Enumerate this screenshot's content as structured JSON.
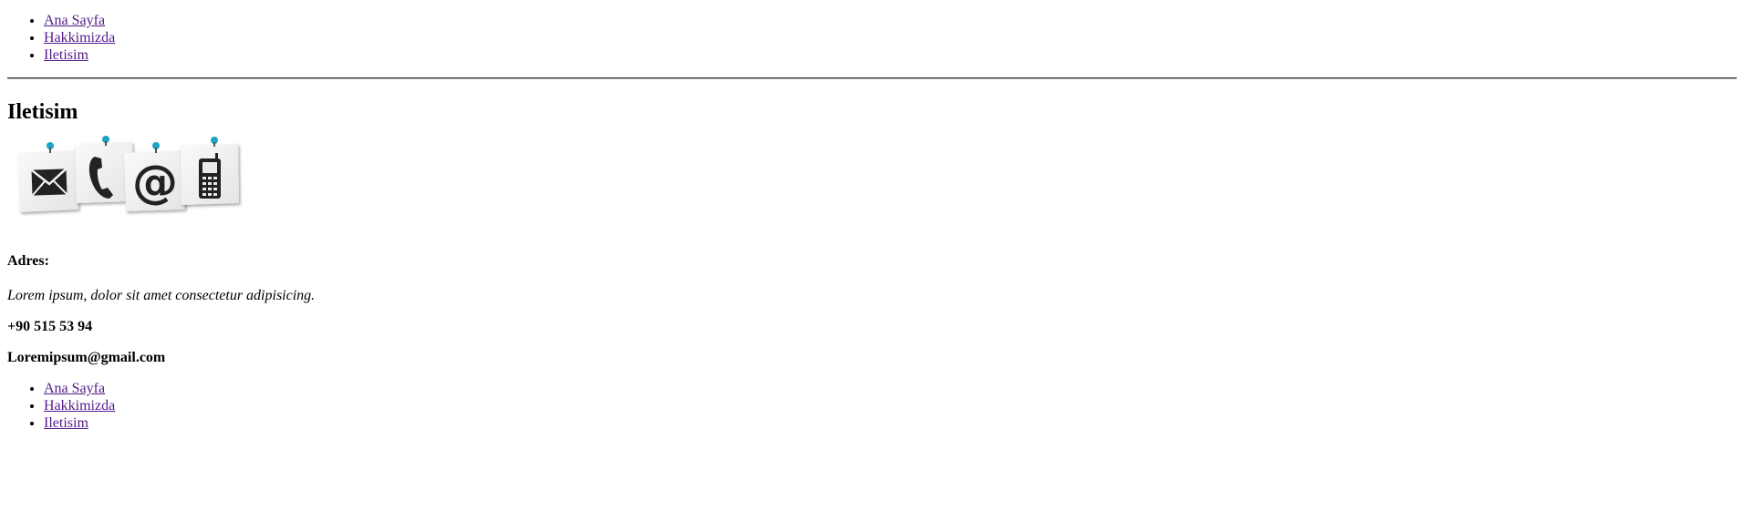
{
  "nav_top": {
    "items": [
      {
        "label": "Ana Sayfa"
      },
      {
        "label": "Hakkimizda"
      },
      {
        "label": "Iletisim"
      }
    ]
  },
  "main": {
    "title": "Iletisim",
    "contact_icons": [
      "envelope-icon",
      "phone-icon",
      "at-sign-icon",
      "mobile-phone-icon"
    ],
    "address_label": "Adres:",
    "address_text": "Lorem ipsum, dolor sit amet consectetur adipisicing.",
    "phone": "+90 515 53 94",
    "email": "Loremipsum@gmail.com"
  },
  "nav_bottom": {
    "items": [
      {
        "label": "Ana Sayfa"
      },
      {
        "label": "Hakkimizda"
      },
      {
        "label": "Iletisim"
      }
    ]
  },
  "colors": {
    "link": "#551a8b",
    "pin": "#1ea3c4"
  }
}
